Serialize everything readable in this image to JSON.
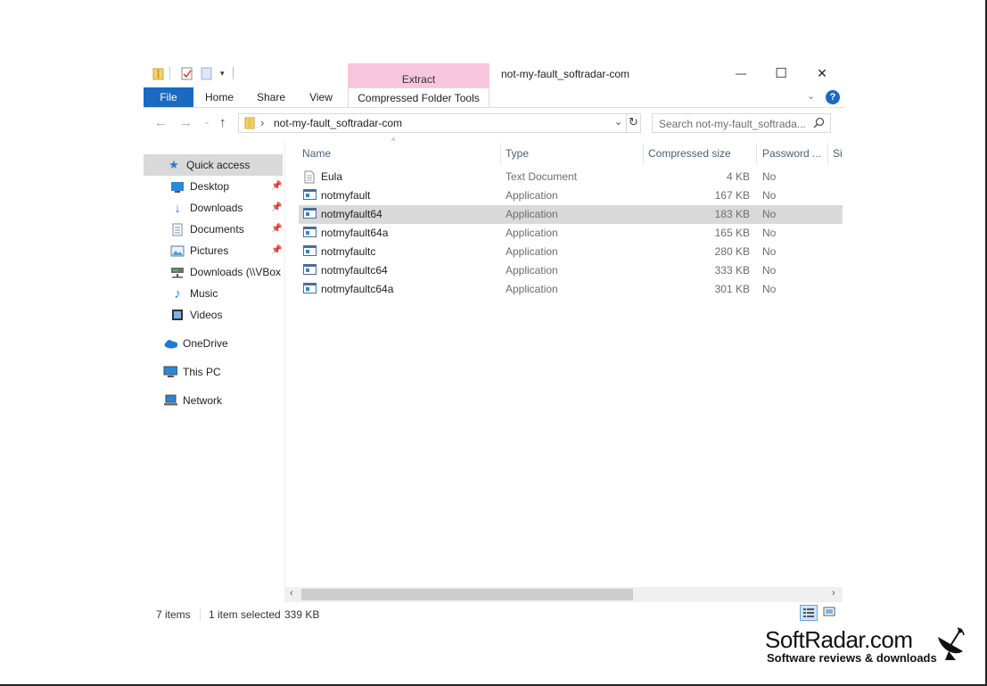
{
  "window": {
    "title": "not-my-fault_softradar-com",
    "contextual_group": "Extract",
    "controls": {
      "minimize": "—",
      "maximize": "☐",
      "close": "✕"
    }
  },
  "ribbon": {
    "tabs": [
      "File",
      "Home",
      "Share",
      "View"
    ],
    "contextual_tab": "Compressed Folder Tools",
    "help": "?"
  },
  "address": {
    "path": "not-my-fault_softradar-com",
    "separator": "›",
    "search_placeholder": "Search not-my-fault_softrada..."
  },
  "nav": {
    "quick_access": "Quick access",
    "items": [
      {
        "label": "Desktop",
        "icon": "desktop-icon",
        "pinned": true
      },
      {
        "label": "Downloads",
        "icon": "downloads-icon",
        "pinned": true
      },
      {
        "label": "Documents",
        "icon": "documents-icon",
        "pinned": true
      },
      {
        "label": "Pictures",
        "icon": "pictures-icon",
        "pinned": true
      },
      {
        "label": "Downloads (\\\\VBox",
        "icon": "network-drive-icon",
        "pinned": false
      },
      {
        "label": "Music",
        "icon": "music-icon",
        "pinned": false
      },
      {
        "label": "Videos",
        "icon": "videos-icon",
        "pinned": false
      }
    ],
    "onedrive": "OneDrive",
    "this_pc": "This PC",
    "network": "Network",
    "pin_glyph": "📌"
  },
  "columns": {
    "name": "Name",
    "type": "Type",
    "compressed_size": "Compressed size",
    "password": "Password ...",
    "size": "Si"
  },
  "files": [
    {
      "name": "Eula",
      "type": "Text Document",
      "size": "4 KB",
      "password": "No",
      "icon": "text-file-icon",
      "selected": false
    },
    {
      "name": "notmyfault",
      "type": "Application",
      "size": "167 KB",
      "password": "No",
      "icon": "app-icon",
      "selected": false
    },
    {
      "name": "notmyfault64",
      "type": "Application",
      "size": "183 KB",
      "password": "No",
      "icon": "app-icon",
      "selected": true
    },
    {
      "name": "notmyfault64a",
      "type": "Application",
      "size": "165 KB",
      "password": "No",
      "icon": "app-icon",
      "selected": false
    },
    {
      "name": "notmyfaultc",
      "type": "Application",
      "size": "280 KB",
      "password": "No",
      "icon": "app-icon",
      "selected": false
    },
    {
      "name": "notmyfaultc64",
      "type": "Application",
      "size": "333 KB",
      "password": "No",
      "icon": "app-icon",
      "selected": false
    },
    {
      "name": "notmyfaultc64a",
      "type": "Application",
      "size": "301 KB",
      "password": "No",
      "icon": "app-icon",
      "selected": false
    }
  ],
  "status": {
    "items": "7 items",
    "selected": "1 item selected",
    "selected_size": "339 KB"
  },
  "watermark": {
    "title": "SoftRadar.com",
    "subtitle": "Software reviews & downloads"
  },
  "colors": {
    "accent": "#1a6ac2",
    "extract_tab": "#f7c6dd",
    "selection": "#d9d9d9"
  }
}
